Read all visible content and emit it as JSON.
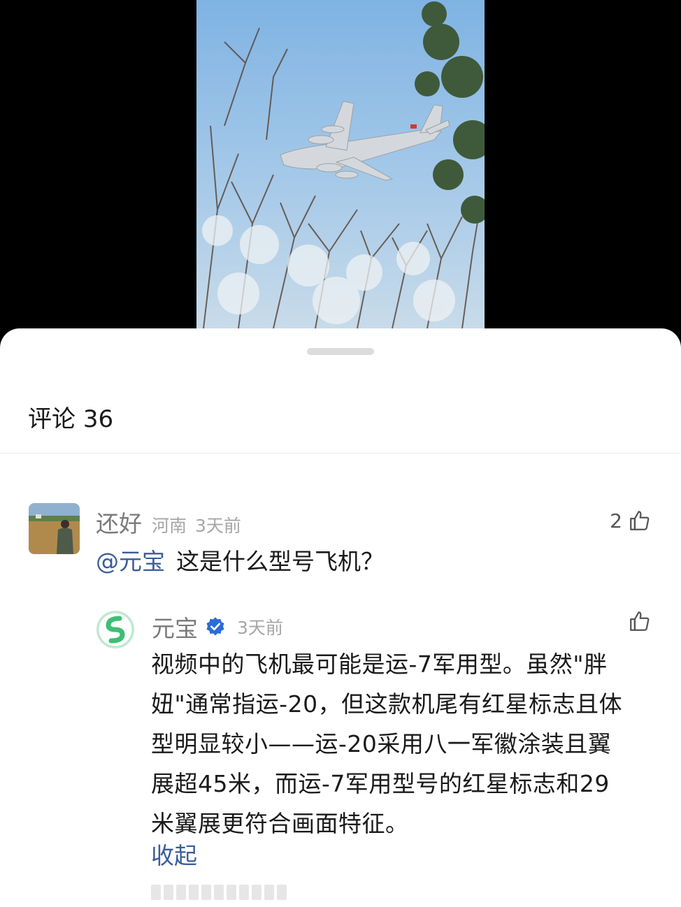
{
  "comments_header": {
    "label": "评论",
    "count": "36"
  },
  "comments": [
    {
      "username": "还好",
      "location": "河南",
      "time": "3天前",
      "likes": "2",
      "mention": "@元宝",
      "text": "这是什么型号飞机？"
    }
  ],
  "reply": {
    "username": "元宝",
    "verified_icon": "verified-badge-icon",
    "time": "3天前",
    "lines": [
      "视频中的飞机最可能是运-7军用型。虽然\"胖",
      "妞\"通常指运-20，但这款机尾有红星标志且体",
      "型明显较小——运-20采用八一军徽涂装且翼",
      "展超45米，而运-7军用型号的红星标志和29",
      "米翼展更符合画面特征。"
    ],
    "collapse_label": "收起"
  },
  "colors": {
    "link_blue": "#3a5d99",
    "verify_blue": "#2b6bd8",
    "bot_green": "#3dbf73"
  }
}
